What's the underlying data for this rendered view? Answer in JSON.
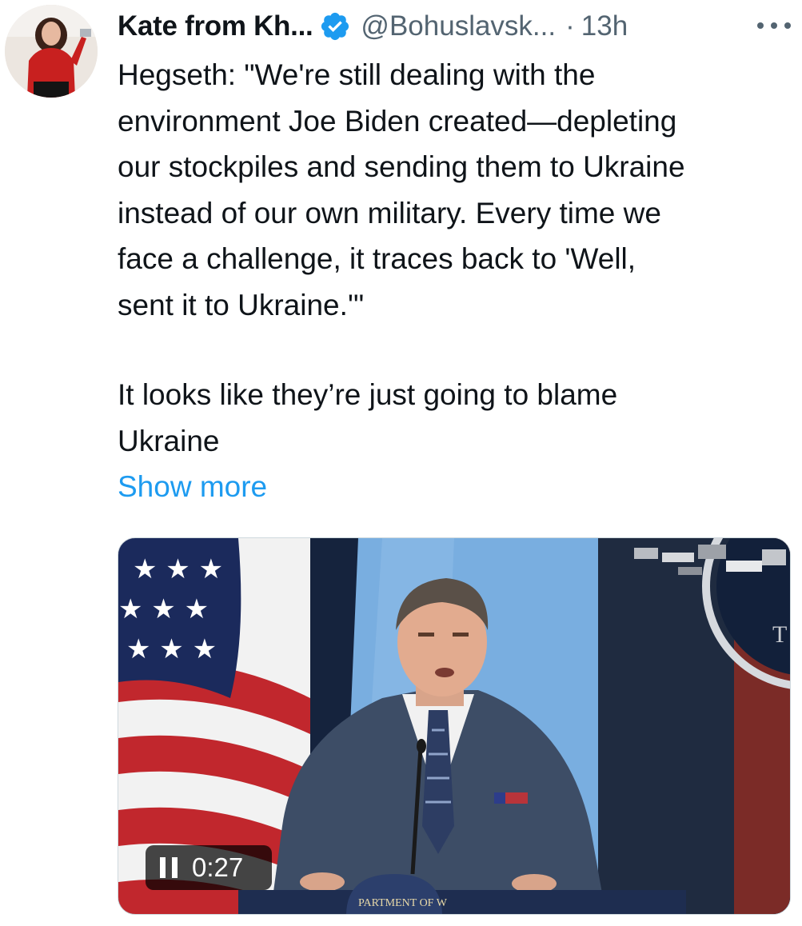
{
  "author": {
    "display_name": "Kate from Kh...",
    "handle": "@Bohuslavsk...",
    "separator": "·",
    "time": "13h"
  },
  "tweet": {
    "paragraph1": "Hegseth: \"We're still dealing with the\nenvironment Joe Biden created—depleting\nour stockpiles and sending them to Ukraine\ninstead of our own military. Every time we\nface a challenge, it traces back to 'Well,\nsent it to Ukraine.'\"",
    "paragraph2": "It looks like they’re just going to blame\nUkraine",
    "show_more": "Show more"
  },
  "media": {
    "type": "video",
    "duration": "0:27",
    "playing": true,
    "seal_text": "PARTMENT OF W",
    "wall_letter": "T"
  },
  "icons": {
    "verified": "verified-badge-icon",
    "more": "more-options-icon",
    "pause": "pause-icon"
  },
  "colors": {
    "verified_blue": "#1d9bf0",
    "link_blue": "#1d9bf0",
    "secondary_text": "#536471"
  }
}
